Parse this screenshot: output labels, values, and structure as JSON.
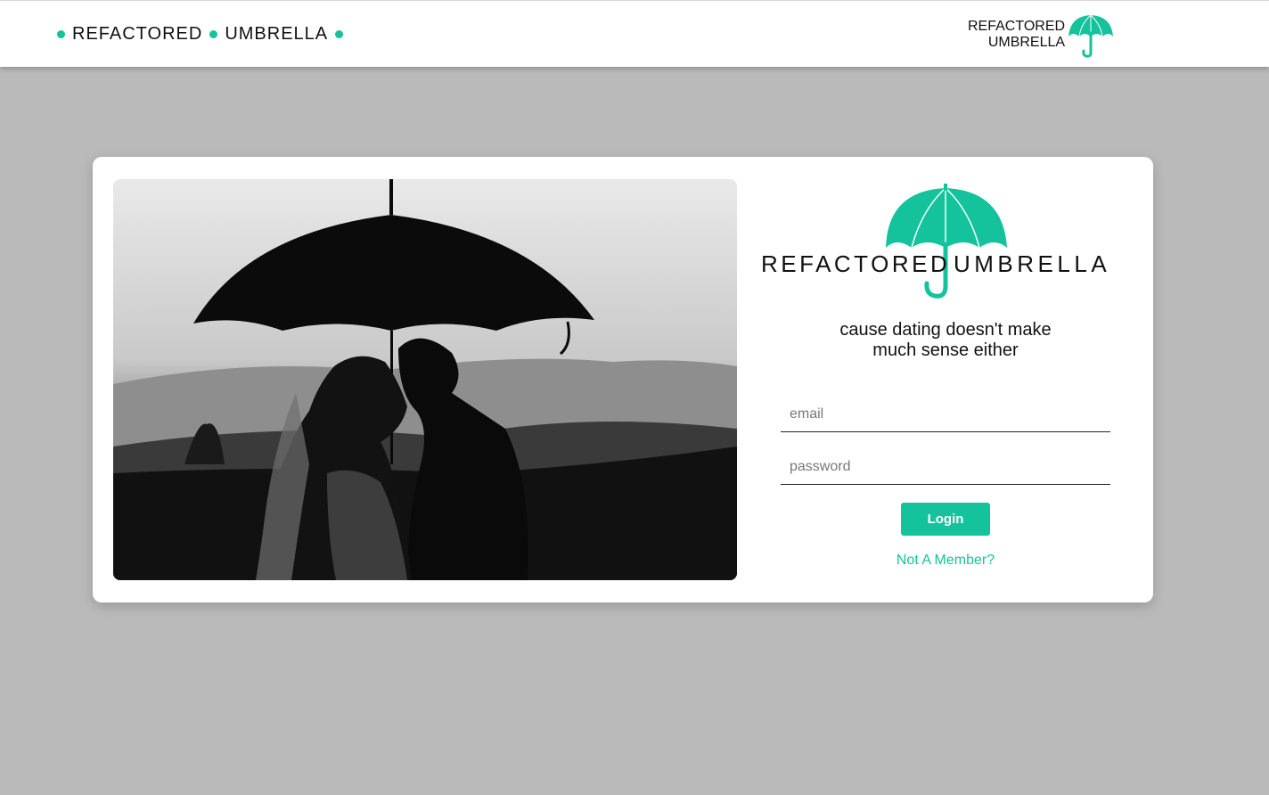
{
  "nav": {
    "word1": "REFACTORED",
    "word2": "UMBRELLA",
    "logo_line1": "REFACTORED",
    "logo_line2": "UMBRELLA"
  },
  "login": {
    "logo_left": "REFACTORED",
    "logo_right": "UMBRELLA",
    "tagline_line1": "cause dating doesn't make",
    "tagline_line2": "much sense either",
    "email_placeholder": "email",
    "password_placeholder": "password",
    "login_label": "Login",
    "member_link": "Not A Member?"
  },
  "icons": {
    "umbrella": "umbrella-icon",
    "bullet": "dot-icon"
  },
  "colors": {
    "accent": "#14c39b",
    "background": "#bababa"
  }
}
